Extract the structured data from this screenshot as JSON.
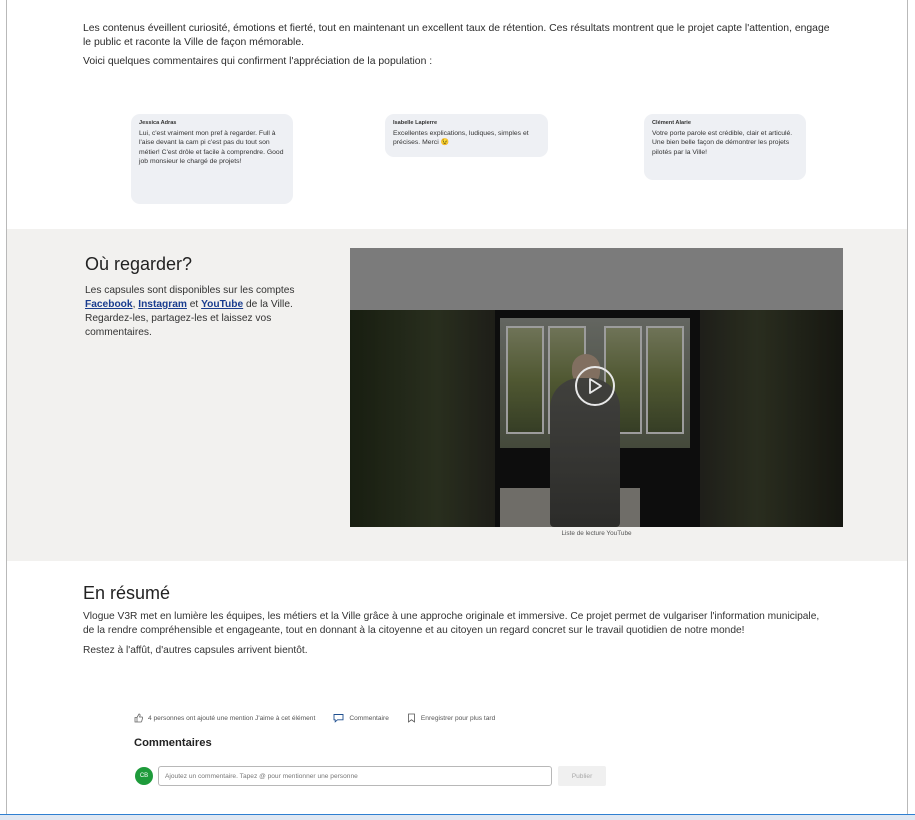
{
  "intro": {
    "paragraph1": "Les contenus éveillent curiosité, émotions et fierté, tout en maintenant un excellent taux de rétention. Ces résultats montrent que le projet capte l'attention, engage le public et raconte la Ville de façon mémorable.",
    "paragraph2": "Voici quelques commentaires qui confirment l'appréciation de la population :"
  },
  "testimonials": [
    {
      "name": "Jessica Adras",
      "text": "Lui, c'est vraiment mon pref à regarder. Full à l'aise devant la cam pi c'est pas du tout son métier! C'est drôle et facile à comprendre. Good job monsieur le chargé de projets!"
    },
    {
      "name": "Isabelle Lapierre",
      "text": "Excellentes explications, ludiques, simples et précises. Merci 😉"
    },
    {
      "name": "Clément Alarie",
      "text": "Votre porte parole est crédible, clair et articulé. Une bien belle façon de démontrer les projets pilotés par la Ville!"
    }
  ],
  "where": {
    "title": "Où regarder?",
    "text_before": "Les capsules sont disponibles sur les comptes ",
    "link_facebook": "Facebook",
    "sep1": ", ",
    "link_instagram": "Instagram",
    "sep2": " et ",
    "link_youtube": "YouTube",
    "text_after": " de la Ville. Regardez-les, partagez-les et laissez vos commentaires."
  },
  "video": {
    "caption": "Liste de lecture YouTube",
    "play_icon": "play-icon"
  },
  "summary": {
    "title": "En résumé",
    "paragraph1": "Vlogue V3R met en lumière les équipes, les métiers et la Ville grâce à une approche originale et immersive. Ce projet permet de vulgariser l'information municipale, de la rendre compréhensible et engageante, tout en donnant à la citoyenne et au citoyen un regard concret sur le travail quotidien de notre monde!",
    "paragraph2": "Restez à l'affût, d'autres capsules arrivent bientôt."
  },
  "actions": {
    "like_text": "4 personnes ont ajouté une mention J'aime à cet élément",
    "comment_label": "Commentaire",
    "save_label": "Enregistrer pour plus tard"
  },
  "comments": {
    "title": "Commentaires",
    "avatar_initials": "CB",
    "input_placeholder": "Ajoutez un commentaire. Tapez @ pour mentionner une personne",
    "publish_label": "Publier"
  },
  "colors": {
    "band_bg": "#f2f1ef",
    "link": "#1a3d8f",
    "avatar": "#1e9b3b"
  }
}
